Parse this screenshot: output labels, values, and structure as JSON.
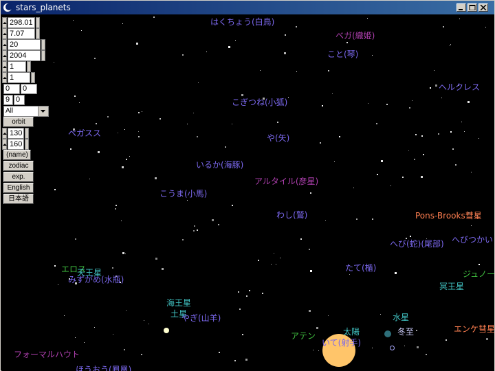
{
  "window": {
    "title": "stars_planets"
  },
  "controls": {
    "spin1": "298.01",
    "spin2": "7.07",
    "spin3": "20",
    "spin4": "2004",
    "spin5": "1",
    "spin6": "1",
    "field_a1": "0",
    "field_a2": "0",
    "field_b1": "9",
    "field_b2": "0",
    "select_value": "All",
    "orbit_label": "orbit",
    "spin7": "130",
    "spin8": "160",
    "name_label": "(name)",
    "zodiac_label": "zodiac",
    "exp_label": "exp.",
    "english_label": "English",
    "japanese_label": "日本語"
  },
  "labels": {
    "hakucho": "はくちょう(白鳥)",
    "vega": "ベガ(織姫)",
    "koto": "こと(琴)",
    "hercules": "ヘルクレス",
    "kogitsune": "こぎつね(小狐)",
    "pegasus": "ペガスス",
    "ya": "や(矢)",
    "iruka": "いるか(海豚)",
    "altair": "アルタイル(彦星)",
    "kouma": "こうま(小馬)",
    "washi": "わし(鷲)",
    "pons": "Pons-Brooks彗星",
    "hebi": "へび(蛇)(尾部)",
    "hebitsukai": "へびつかい",
    "eros": "エロス",
    "tennou": "天王星",
    "mizugame": "みずがめ(水瓶)",
    "tate": "たて(楯)",
    "juno": "ジュノー",
    "meiou": "冥王星",
    "kaiou": "海王星",
    "dosei": "土星",
    "yagi": "やぎ(山羊)",
    "suisei": "水星",
    "taiyou": "太陽",
    "touji": "冬至",
    "aten": "アテン",
    "iteza": "いて(射手)",
    "encke": "エンケ彗星",
    "fomalhaut": "フォーマルハウト",
    "bottom_partial": "ほうおう(鳳凰)"
  },
  "colors": {
    "constellation": "#7b68ee",
    "star_name": "#b040b0",
    "planet": "#40c0c0",
    "comet": "#ff7f50",
    "asteroid": "#40c040",
    "solstice": "#d0d0ff"
  }
}
